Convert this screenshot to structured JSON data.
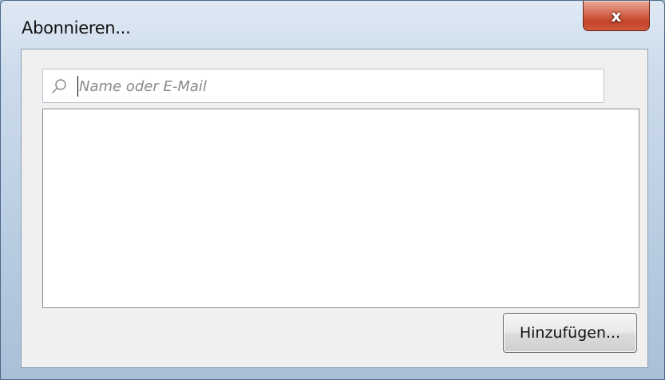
{
  "window": {
    "title": "Abonnieren...",
    "close_glyph": "x"
  },
  "search": {
    "placeholder": "Name oder E-Mail",
    "value": "",
    "icon": "search-icon"
  },
  "results": {
    "items": []
  },
  "actions": {
    "add_label": "Hinzufügen..."
  },
  "colors": {
    "frame": "#bccfe3",
    "close_button": "#c2432a",
    "client_background": "#f0f0f0"
  }
}
